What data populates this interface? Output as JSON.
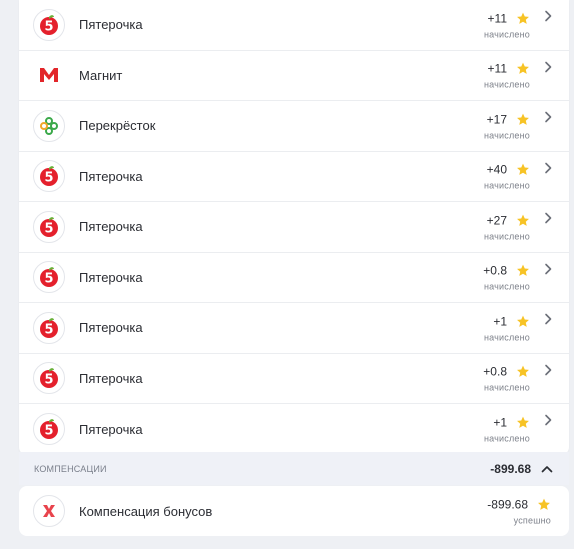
{
  "transactions": [
    {
      "name": "Пятерочка",
      "amount": "+11",
      "status": "начислено",
      "logo": "pyaterochka-logo"
    },
    {
      "name": "Магнит",
      "amount": "+11",
      "status": "начислено",
      "logo": "magnit-logo"
    },
    {
      "name": "Перекрёсток",
      "amount": "+17",
      "status": "начислено",
      "logo": "perekrestok-logo"
    },
    {
      "name": "Пятерочка",
      "amount": "+40",
      "status": "начислено",
      "logo": "pyaterochka-logo"
    },
    {
      "name": "Пятерочка",
      "amount": "+27",
      "status": "начислено",
      "logo": "pyaterochka-logo"
    },
    {
      "name": "Пятерочка",
      "amount": "+0.8",
      "status": "начислено",
      "logo": "pyaterochka-logo"
    },
    {
      "name": "Пятерочка",
      "amount": "+1",
      "status": "начислено",
      "logo": "pyaterochka-logo"
    },
    {
      "name": "Пятерочка",
      "amount": "+0.8",
      "status": "начислено",
      "logo": "pyaterochka-logo"
    },
    {
      "name": "Пятерочка",
      "amount": "+1",
      "status": "начислено",
      "logo": "pyaterochka-logo"
    }
  ],
  "compensation": {
    "title": "КОМПЕНСАЦИИ",
    "total": "-899.68",
    "item": {
      "name": "Компенсация бонусов",
      "amount": "-899.68",
      "status": "успешно",
      "logo": "compensation-logo"
    }
  },
  "colors": {
    "star": "#f7c325",
    "pyaterochka_red": "#e4202c",
    "pyaterochka_green": "#6ab23a",
    "magnit_red": "#e2262a",
    "perekrestok_green": "#3ba94a",
    "compensation_red": "#e8434c"
  }
}
